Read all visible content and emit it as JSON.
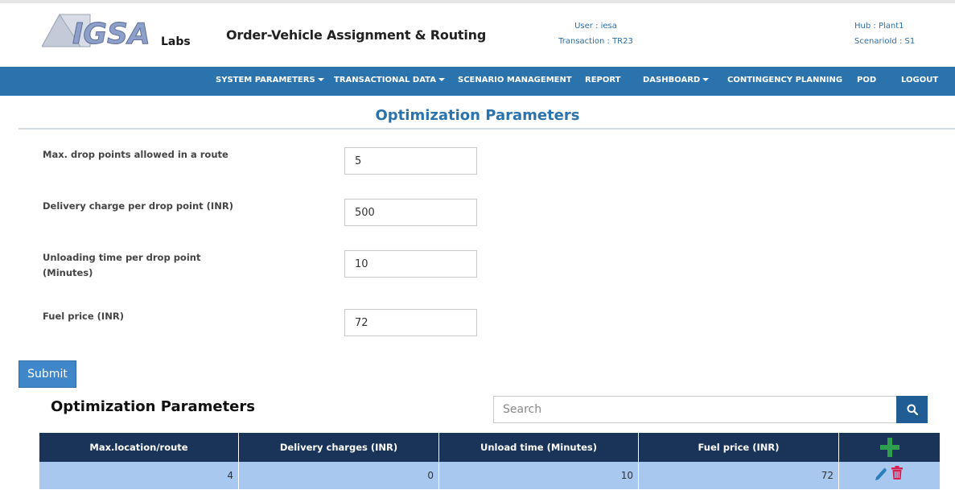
{
  "header": {
    "logo_text": "IGSA Labs",
    "app_title": "Order-Vehicle Assignment & Routing",
    "user_label": "User :",
    "user_value": "iesa",
    "transaction_label": "Transaction :",
    "transaction_value": "TR23",
    "hub_label": "Hub :",
    "hub_value": "Plant1",
    "scenario_label": "ScenarioId :",
    "scenario_value": "S1"
  },
  "nav": {
    "items": [
      {
        "label": "SYSTEM PARAMETERS",
        "dropdown": true
      },
      {
        "label": "TRANSACTIONAL DATA",
        "dropdown": true
      },
      {
        "label": "SCENARIO MANAGEMENT",
        "dropdown": false
      },
      {
        "label": "REPORT",
        "dropdown": false
      },
      {
        "label": "DASHBOARD",
        "dropdown": true
      },
      {
        "label": "CONTINGENCY PLANNING",
        "dropdown": false
      },
      {
        "label": "POD",
        "dropdown": false
      },
      {
        "label": "LOGOUT",
        "dropdown": false
      }
    ]
  },
  "form": {
    "title": "Optimization Parameters",
    "fields": [
      {
        "label": "Max. drop points allowed in a route",
        "value": "5"
      },
      {
        "label": "Delivery charge per drop point (INR)",
        "value": "500"
      },
      {
        "label": "Unloading time per drop point (Minutes)",
        "value": "10"
      },
      {
        "label": "Fuel price (INR)",
        "value": "72"
      }
    ],
    "submit_label": "Submit"
  },
  "table": {
    "title": "Optimization Parameters",
    "search_placeholder": "Search",
    "columns": [
      "Max.location/route",
      "Delivery charges (INR)",
      "Unload time (Minutes)",
      "Fuel price (INR)"
    ],
    "rows": [
      {
        "max_location": "4",
        "delivery_charges": "0",
        "unload_time": "10",
        "fuel_price": "72"
      }
    ]
  },
  "colors": {
    "nav_bg": "#2b73ad",
    "title_blue": "#2b73ad",
    "table_header": "#1a3358",
    "row_bg": "#a9c8f0",
    "add_green": "#2e9e4f",
    "delete_red": "#d9204f",
    "edit_blue": "#2a7fba"
  }
}
